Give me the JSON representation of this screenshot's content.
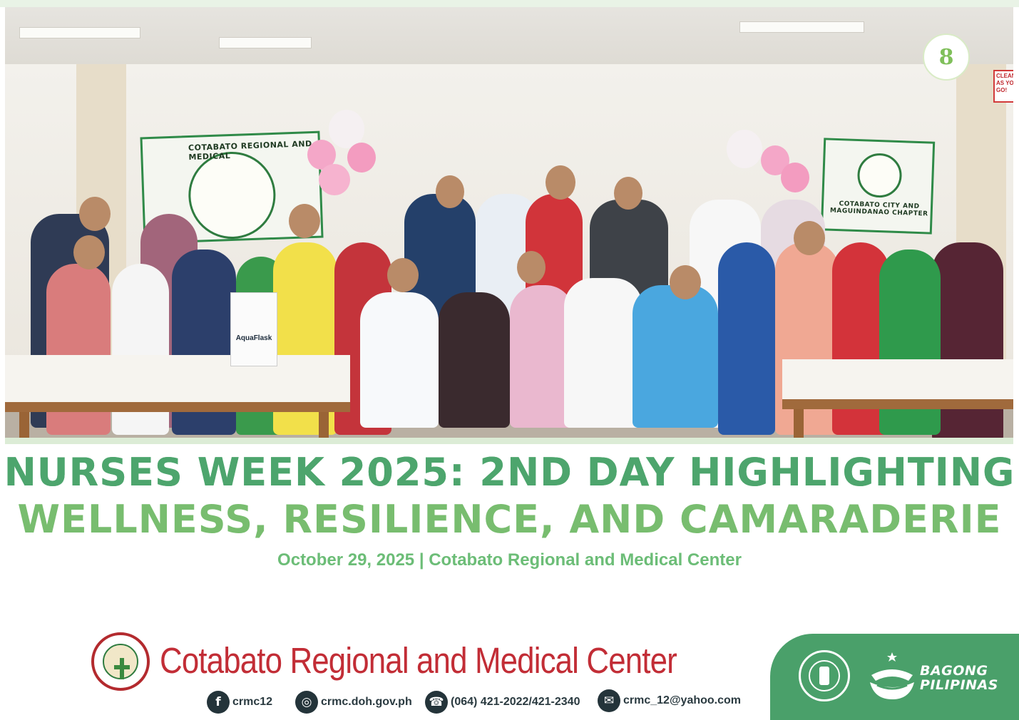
{
  "headline": {
    "line1": "NURSES WEEK 2025: 2ND DAY HIGHLIGHTING",
    "line2": "WELLNESS, RESILIENCE, AND CAMARADERIE"
  },
  "subline": "October 29, 2025 | Cotabato Regional and Medical Center",
  "photo": {
    "banner_left_text": "COTABATO REGIONAL AND MEDICAL",
    "banner_right_text": "COTABATO CITY AND MAGUINDANAO CHAPTER",
    "bag_text": "AquaFlask",
    "sign_text": "CLEAN AS YOU GO!"
  },
  "footer": {
    "org_name": "Cotabato Regional and Medical Center",
    "contacts": {
      "facebook": "crmc12",
      "website": "crmc.doh.gov.ph",
      "phone": "(064) 421-2022/421-2340",
      "email": "crmc_12@yahoo.com"
    },
    "brand": "BAGONG PILIPINAS"
  },
  "colors": {
    "headline_green": "#4faa6f",
    "subline_green": "#6cbd77",
    "org_red": "#c22d36",
    "panel_green": "#4aa06a"
  },
  "icons": [
    "facebook-icon",
    "globe-icon",
    "phone-icon",
    "mail-icon"
  ]
}
